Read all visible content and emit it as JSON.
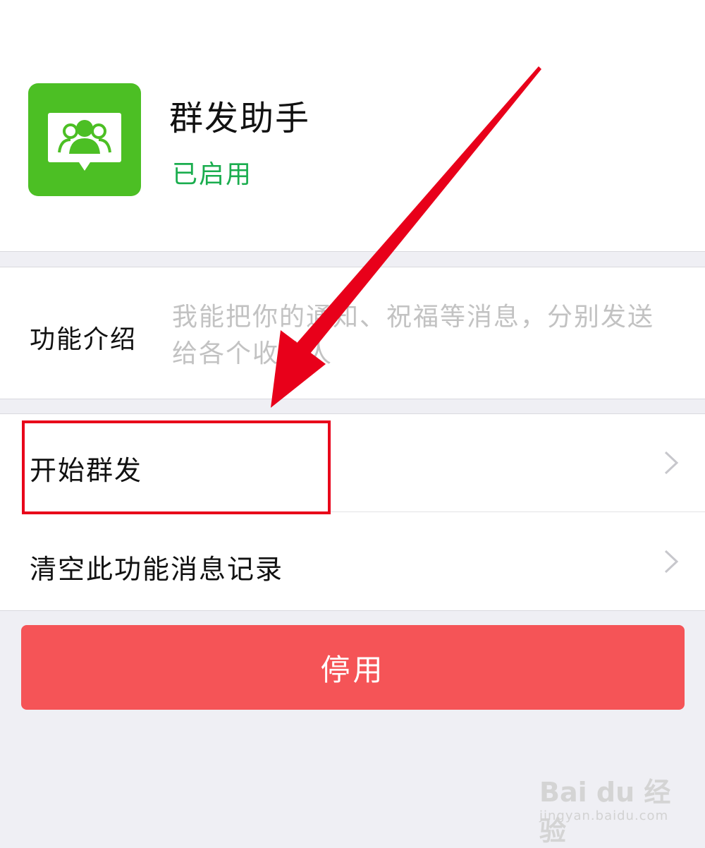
{
  "app": {
    "name": "群发助手",
    "status": "已启用",
    "status_color": "#1aad4e",
    "icon": "group-people-icon",
    "icon_color": "#4cbf24"
  },
  "intro": {
    "label": "功能介绍",
    "text": "我能把你的通知、祝福等消息，分别发送给各个收件人"
  },
  "menu": [
    {
      "label": "开始群发",
      "icon": "chevron-right-icon"
    },
    {
      "label": "清空此功能消息记录",
      "icon": "chevron-right-icon"
    }
  ],
  "disable_button": {
    "label": "停用",
    "color": "#f55457"
  },
  "annotation": {
    "arrow_color": "#e8001a",
    "box_color": "#e8001a"
  },
  "watermark": {
    "brand": "Bai du 经验",
    "url": "jingyan.baidu.com"
  }
}
